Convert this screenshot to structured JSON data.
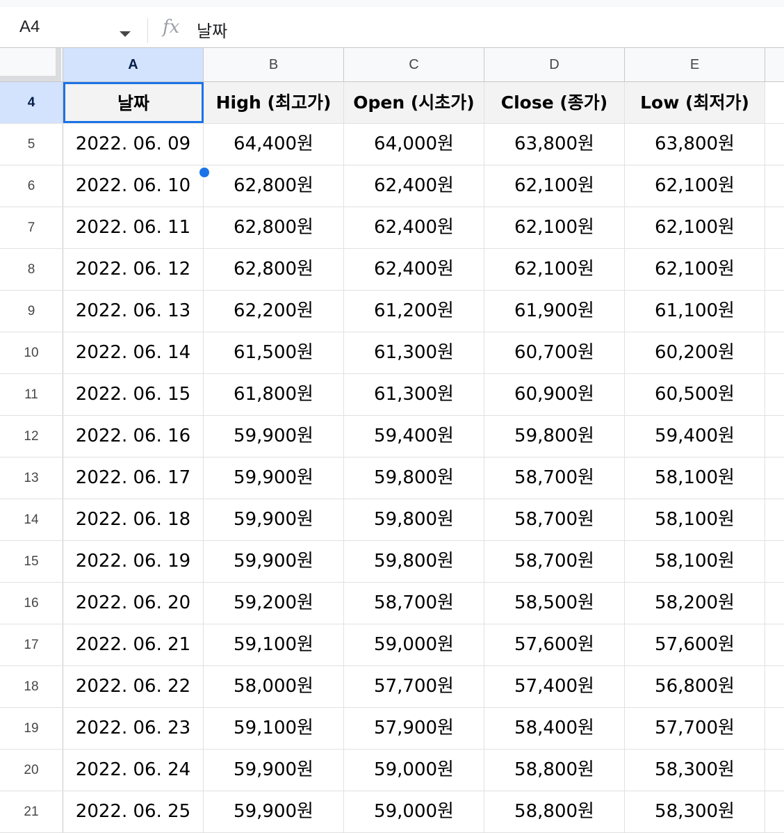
{
  "formula_bar": {
    "cell_ref": "A4",
    "fx_label": "fx",
    "content": "날짜"
  },
  "columns": [
    "A",
    "B",
    "C",
    "D",
    "E"
  ],
  "header_row": {
    "row_number": "4",
    "cells": [
      "날짜",
      "High (최고가)",
      "Open (시초가)",
      "Close (종가)",
      "Low (최저가)"
    ]
  },
  "rows": [
    {
      "n": "5",
      "cells": [
        "2022. 06. 09",
        "64,400원",
        "64,000원",
        "63,800원",
        "63,800원"
      ]
    },
    {
      "n": "6",
      "cells": [
        "2022. 06. 10",
        "62,800원",
        "62,400원",
        "62,100원",
        "62,100원"
      ]
    },
    {
      "n": "7",
      "cells": [
        "2022. 06. 11",
        "62,800원",
        "62,400원",
        "62,100원",
        "62,100원"
      ]
    },
    {
      "n": "8",
      "cells": [
        "2022. 06. 12",
        "62,800원",
        "62,400원",
        "62,100원",
        "62,100원"
      ]
    },
    {
      "n": "9",
      "cells": [
        "2022. 06. 13",
        "62,200원",
        "61,200원",
        "61,900원",
        "61,100원"
      ]
    },
    {
      "n": "10",
      "cells": [
        "2022. 06. 14",
        "61,500원",
        "61,300원",
        "60,700원",
        "60,200원"
      ]
    },
    {
      "n": "11",
      "cells": [
        "2022. 06. 15",
        "61,800원",
        "61,300원",
        "60,900원",
        "60,500원"
      ]
    },
    {
      "n": "12",
      "cells": [
        "2022. 06. 16",
        "59,900원",
        "59,400원",
        "59,800원",
        "59,400원"
      ]
    },
    {
      "n": "13",
      "cells": [
        "2022. 06. 17",
        "59,900원",
        "59,800원",
        "58,700원",
        "58,100원"
      ]
    },
    {
      "n": "14",
      "cells": [
        "2022. 06. 18",
        "59,900원",
        "59,800원",
        "58,700원",
        "58,100원"
      ]
    },
    {
      "n": "15",
      "cells": [
        "2022. 06. 19",
        "59,900원",
        "59,800원",
        "58,700원",
        "58,100원"
      ]
    },
    {
      "n": "16",
      "cells": [
        "2022. 06. 20",
        "59,200원",
        "58,700원",
        "58,500원",
        "58,200원"
      ]
    },
    {
      "n": "17",
      "cells": [
        "2022. 06. 21",
        "59,100원",
        "59,000원",
        "57,600원",
        "57,600원"
      ]
    },
    {
      "n": "18",
      "cells": [
        "2022. 06. 22",
        "58,000원",
        "57,700원",
        "57,400원",
        "56,800원"
      ]
    },
    {
      "n": "19",
      "cells": [
        "2022. 06. 23",
        "59,100원",
        "57,900원",
        "58,400원",
        "57,700원"
      ]
    },
    {
      "n": "20",
      "cells": [
        "2022. 06. 24",
        "59,900원",
        "59,000원",
        "58,800원",
        "58,300원"
      ]
    },
    {
      "n": "21",
      "cells": [
        "2022. 06. 25",
        "59,900원",
        "59,000원",
        "58,800원",
        "58,300원"
      ]
    }
  ]
}
